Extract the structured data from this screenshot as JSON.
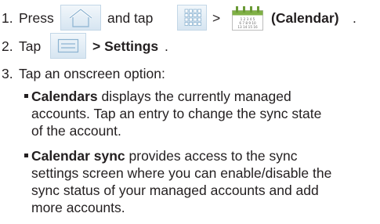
{
  "steps": [
    {
      "num": "1.",
      "parts": {
        "press": "Press",
        "and_tap": "and tap",
        "gt": ">",
        "calendar": "(Calendar)",
        "end": "."
      }
    },
    {
      "num": "2.",
      "parts": {
        "tap": "Tap",
        "gt_settings": "> Settings",
        "end": "."
      }
    },
    {
      "num": "3.",
      "text": "Tap an onscreen option:"
    }
  ],
  "options": [
    {
      "name": "Calendars",
      "lines": [
        " displays the currently managed",
        "accounts. Tap an entry to change the sync state",
        "of the account."
      ]
    },
    {
      "name": "Calendar sync",
      "lines": [
        " provides access to the sync",
        "settings screen where you can enable/disable the",
        "sync status of your managed accounts and add",
        "more accounts."
      ]
    }
  ],
  "icons": [
    "home-icon",
    "apps-grid-icon",
    "calendar-app-icon",
    "menu-icon"
  ],
  "calendar_icon_dates": [
    "1 2 3 4 5",
    "6 7 8 9 10",
    "13 14 15 16"
  ],
  "colors": {
    "icon_blue_light": "#e4eef6",
    "icon_blue_border": "#a9c6dc",
    "calendar_green": "#7fb045",
    "text": "#231f20"
  }
}
